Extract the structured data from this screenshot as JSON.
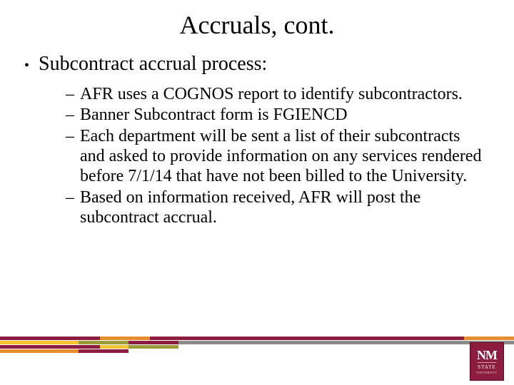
{
  "title": "Accruals, cont.",
  "bullet": {
    "label": "Subcontract accrual process:"
  },
  "subs": {
    "s0": "AFR uses a COGNOS report to identify subcontractors.",
    "s1": "Banner Subcontract form is FGIENCD",
    "s2": "Each department will be sent a list of their subcontracts and asked to provide information on any services rendered before 7/1/14  that have not been billed to the University.",
    "s3": "Based on information received, AFR will post the subcontract accrual."
  },
  "logo": {
    "line1": "NM",
    "line2": "STATE",
    "line3": "UNIVERSITY"
  },
  "colors": {
    "crimson": "#8c1d40",
    "orange": "#e48e2d",
    "yellow": "#f4c430",
    "olive": "#9b9b3a",
    "grey": "#8a8a8a"
  }
}
